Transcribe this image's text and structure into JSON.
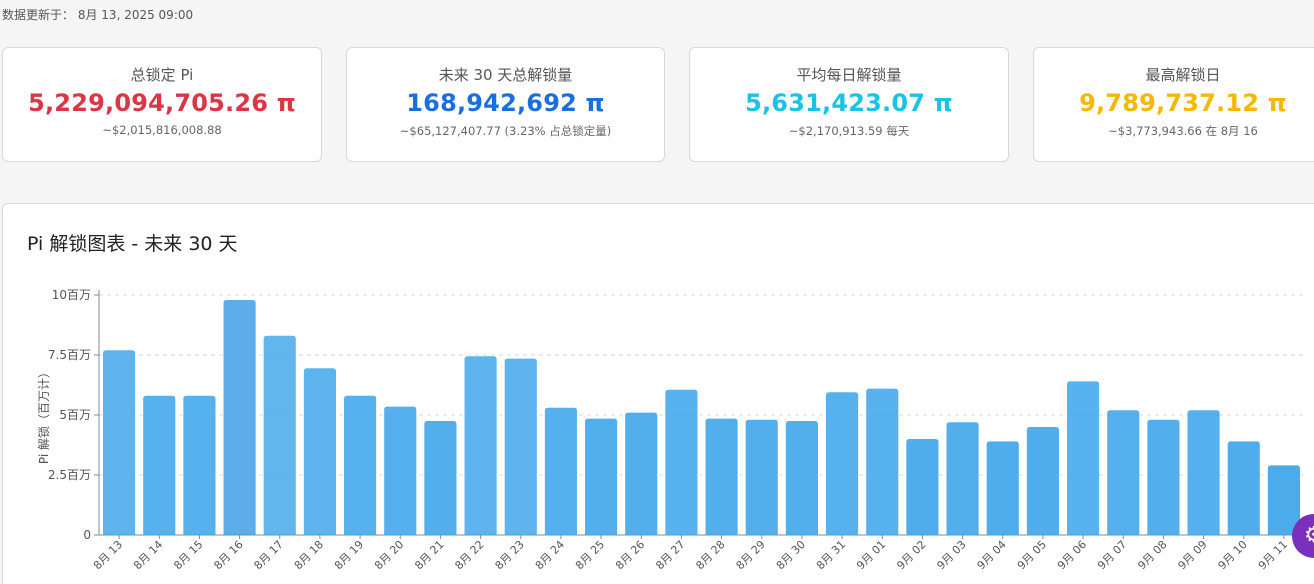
{
  "updated": {
    "label": "数据更新于：",
    "value": "8月 13, 2025 09:00"
  },
  "cards": [
    {
      "label": "总锁定 Pi",
      "value": "5,229,094,705.26 π",
      "sub": "~$2,015,816,008.88",
      "color": "#dc3545"
    },
    {
      "label": "未来 30 天总解锁量",
      "value": "168,942,692 π",
      "sub": "~$65,127,407.77 (3.23% 占总锁定量)",
      "color": "#1a6fdf"
    },
    {
      "label": "平均每日解锁量",
      "value": "5,631,423.07 π",
      "sub": "~$2,170,913.59 每天",
      "color": "#1cc2e6"
    },
    {
      "label": "最高解锁日",
      "value": "9,789,737.12 π",
      "sub": "~$3,773,943.66 在 8月 16",
      "color": "#f5b800"
    }
  ],
  "chart_panel": {
    "title": "Pi 解锁图表 - 未来 30 天"
  },
  "chart_data": {
    "type": "bar",
    "ylabel": "Pi 解锁（百万计）",
    "ylim": [
      0,
      10
    ],
    "yticks": [
      {
        "value": 0,
        "label": "0"
      },
      {
        "value": 2.5,
        "label": "2.5百万"
      },
      {
        "value": 5,
        "label": "5百万"
      },
      {
        "value": 7.5,
        "label": "7.5百万"
      },
      {
        "value": 10,
        "label": "10百万"
      }
    ],
    "grid": true,
    "categories": [
      "8月 13",
      "8月 14",
      "8月 15",
      "8月 16",
      "8月 17",
      "8月 18",
      "8月 19",
      "8月 20",
      "8月 21",
      "8月 22",
      "8月 23",
      "8月 24",
      "8月 25",
      "8月 26",
      "8月 27",
      "8月 28",
      "8月 29",
      "8月 30",
      "8月 31",
      "9月 01",
      "9月 02",
      "9月 03",
      "9月 04",
      "9月 05",
      "9月 06",
      "9月 07",
      "9月 08",
      "9月 09",
      "9月 10",
      "9月 11"
    ],
    "values": [
      7.7,
      5.8,
      5.8,
      9.79,
      8.3,
      6.95,
      5.8,
      5.35,
      4.75,
      7.45,
      7.35,
      5.3,
      4.85,
      5.1,
      6.05,
      4.85,
      4.8,
      4.75,
      5.95,
      6.1,
      4.0,
      4.7,
      3.9,
      4.5,
      6.4,
      5.2,
      4.8,
      5.2,
      3.9,
      2.9
    ],
    "bar_color": "#3da5ea",
    "highlight_color": "#2e96e4"
  },
  "fab": {
    "icon": "gear-icon",
    "glyph": "⚙"
  }
}
